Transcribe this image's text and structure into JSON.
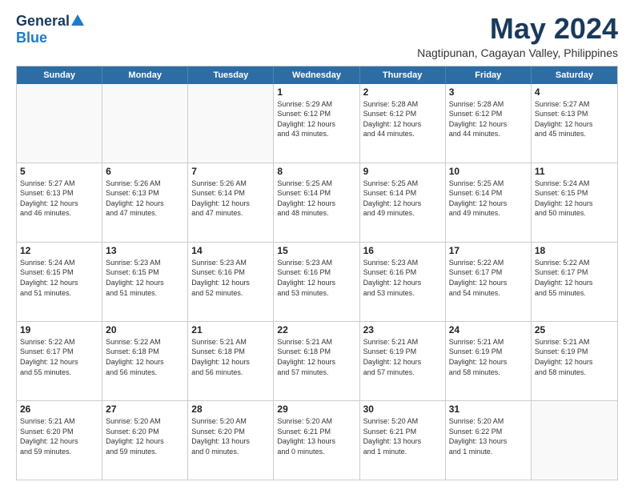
{
  "logo": {
    "general": "General",
    "blue": "Blue"
  },
  "title": {
    "month_year": "May 2024",
    "location": "Nagtipunan, Cagayan Valley, Philippines"
  },
  "calendar": {
    "headers": [
      "Sunday",
      "Monday",
      "Tuesday",
      "Wednesday",
      "Thursday",
      "Friday",
      "Saturday"
    ],
    "weeks": [
      [
        {
          "day": "",
          "text": ""
        },
        {
          "day": "",
          "text": ""
        },
        {
          "day": "",
          "text": ""
        },
        {
          "day": "1",
          "text": "Sunrise: 5:29 AM\nSunset: 6:12 PM\nDaylight: 12 hours\nand 43 minutes."
        },
        {
          "day": "2",
          "text": "Sunrise: 5:28 AM\nSunset: 6:12 PM\nDaylight: 12 hours\nand 44 minutes."
        },
        {
          "day": "3",
          "text": "Sunrise: 5:28 AM\nSunset: 6:12 PM\nDaylight: 12 hours\nand 44 minutes."
        },
        {
          "day": "4",
          "text": "Sunrise: 5:27 AM\nSunset: 6:13 PM\nDaylight: 12 hours\nand 45 minutes."
        }
      ],
      [
        {
          "day": "5",
          "text": "Sunrise: 5:27 AM\nSunset: 6:13 PM\nDaylight: 12 hours\nand 46 minutes."
        },
        {
          "day": "6",
          "text": "Sunrise: 5:26 AM\nSunset: 6:13 PM\nDaylight: 12 hours\nand 47 minutes."
        },
        {
          "day": "7",
          "text": "Sunrise: 5:26 AM\nSunset: 6:14 PM\nDaylight: 12 hours\nand 47 minutes."
        },
        {
          "day": "8",
          "text": "Sunrise: 5:25 AM\nSunset: 6:14 PM\nDaylight: 12 hours\nand 48 minutes."
        },
        {
          "day": "9",
          "text": "Sunrise: 5:25 AM\nSunset: 6:14 PM\nDaylight: 12 hours\nand 49 minutes."
        },
        {
          "day": "10",
          "text": "Sunrise: 5:25 AM\nSunset: 6:14 PM\nDaylight: 12 hours\nand 49 minutes."
        },
        {
          "day": "11",
          "text": "Sunrise: 5:24 AM\nSunset: 6:15 PM\nDaylight: 12 hours\nand 50 minutes."
        }
      ],
      [
        {
          "day": "12",
          "text": "Sunrise: 5:24 AM\nSunset: 6:15 PM\nDaylight: 12 hours\nand 51 minutes."
        },
        {
          "day": "13",
          "text": "Sunrise: 5:23 AM\nSunset: 6:15 PM\nDaylight: 12 hours\nand 51 minutes."
        },
        {
          "day": "14",
          "text": "Sunrise: 5:23 AM\nSunset: 6:16 PM\nDaylight: 12 hours\nand 52 minutes."
        },
        {
          "day": "15",
          "text": "Sunrise: 5:23 AM\nSunset: 6:16 PM\nDaylight: 12 hours\nand 53 minutes."
        },
        {
          "day": "16",
          "text": "Sunrise: 5:23 AM\nSunset: 6:16 PM\nDaylight: 12 hours\nand 53 minutes."
        },
        {
          "day": "17",
          "text": "Sunrise: 5:22 AM\nSunset: 6:17 PM\nDaylight: 12 hours\nand 54 minutes."
        },
        {
          "day": "18",
          "text": "Sunrise: 5:22 AM\nSunset: 6:17 PM\nDaylight: 12 hours\nand 55 minutes."
        }
      ],
      [
        {
          "day": "19",
          "text": "Sunrise: 5:22 AM\nSunset: 6:17 PM\nDaylight: 12 hours\nand 55 minutes."
        },
        {
          "day": "20",
          "text": "Sunrise: 5:22 AM\nSunset: 6:18 PM\nDaylight: 12 hours\nand 56 minutes."
        },
        {
          "day": "21",
          "text": "Sunrise: 5:21 AM\nSunset: 6:18 PM\nDaylight: 12 hours\nand 56 minutes."
        },
        {
          "day": "22",
          "text": "Sunrise: 5:21 AM\nSunset: 6:18 PM\nDaylight: 12 hours\nand 57 minutes."
        },
        {
          "day": "23",
          "text": "Sunrise: 5:21 AM\nSunset: 6:19 PM\nDaylight: 12 hours\nand 57 minutes."
        },
        {
          "day": "24",
          "text": "Sunrise: 5:21 AM\nSunset: 6:19 PM\nDaylight: 12 hours\nand 58 minutes."
        },
        {
          "day": "25",
          "text": "Sunrise: 5:21 AM\nSunset: 6:19 PM\nDaylight: 12 hours\nand 58 minutes."
        }
      ],
      [
        {
          "day": "26",
          "text": "Sunrise: 5:21 AM\nSunset: 6:20 PM\nDaylight: 12 hours\nand 59 minutes."
        },
        {
          "day": "27",
          "text": "Sunrise: 5:20 AM\nSunset: 6:20 PM\nDaylight: 12 hours\nand 59 minutes."
        },
        {
          "day": "28",
          "text": "Sunrise: 5:20 AM\nSunset: 6:20 PM\nDaylight: 13 hours\nand 0 minutes."
        },
        {
          "day": "29",
          "text": "Sunrise: 5:20 AM\nSunset: 6:21 PM\nDaylight: 13 hours\nand 0 minutes."
        },
        {
          "day": "30",
          "text": "Sunrise: 5:20 AM\nSunset: 6:21 PM\nDaylight: 13 hours\nand 1 minute."
        },
        {
          "day": "31",
          "text": "Sunrise: 5:20 AM\nSunset: 6:22 PM\nDaylight: 13 hours\nand 1 minute."
        },
        {
          "day": "",
          "text": ""
        }
      ]
    ]
  }
}
